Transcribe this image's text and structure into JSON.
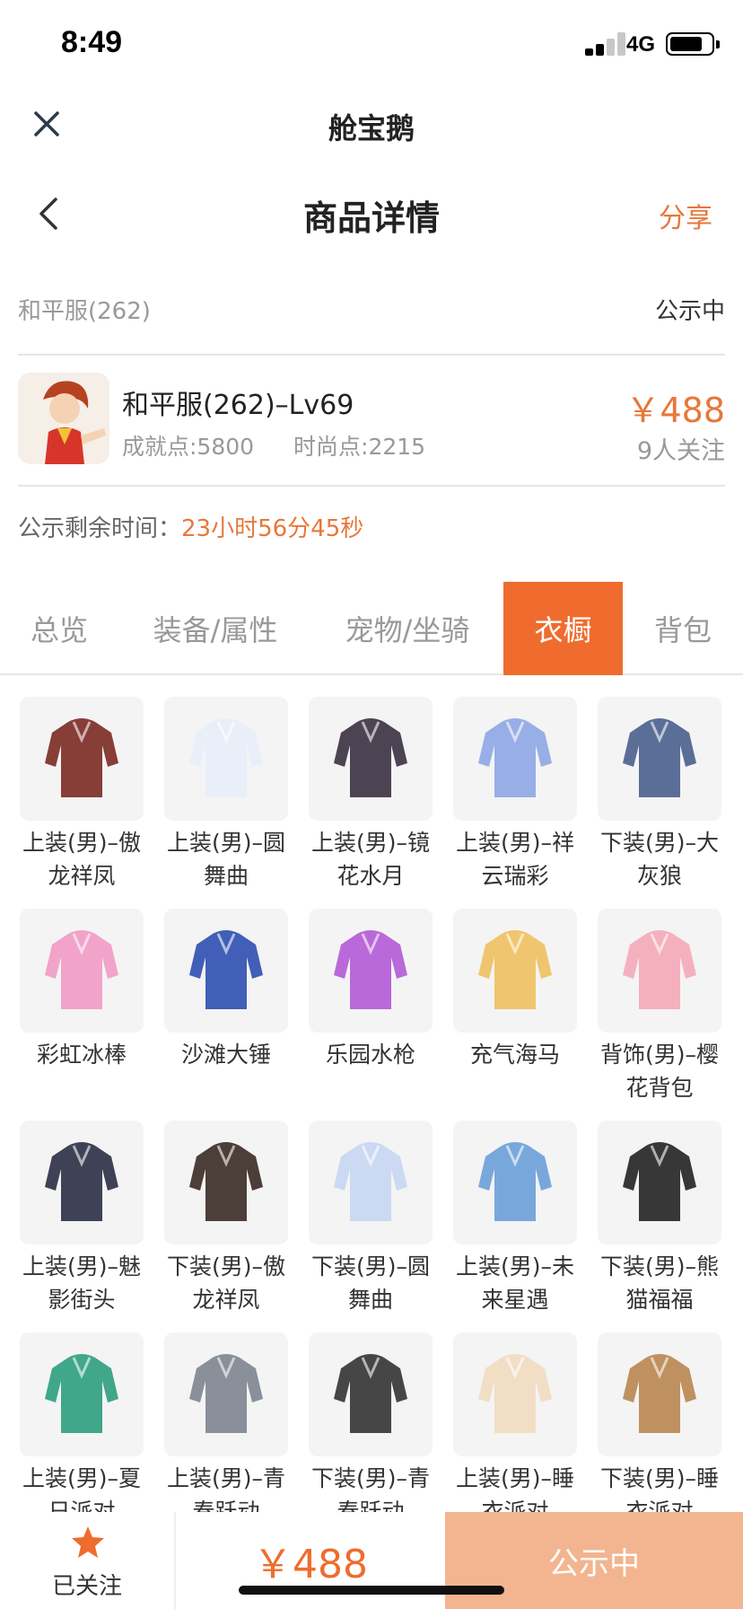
{
  "status_bar": {
    "time": "8:49",
    "network": "4G"
  },
  "app_bar": {
    "title": "舱宝鹅"
  },
  "nav": {
    "title": "商品详情",
    "share": "分享"
  },
  "listing": {
    "server": "和平服(262)",
    "status": "公示中",
    "product_name": "和平服(262)–Lv69",
    "achievement": "成就点:5800",
    "fashion": "时尚点:2215",
    "price": "￥488",
    "followers": "9人关注",
    "countdown_label": "公示剩余时间：",
    "countdown_value": "23小时56分45秒"
  },
  "tabs": [
    {
      "label": "总览",
      "active": false
    },
    {
      "label": "装备/属性",
      "active": false
    },
    {
      "label": "宠物/坐骑",
      "active": false
    },
    {
      "label": "衣橱",
      "active": true
    },
    {
      "label": "背包",
      "active": false
    }
  ],
  "wardrobe": [
    {
      "label": "上装(男)–傲龙祥凤",
      "icon": "dark-armor-top-icon",
      "color": "#7a2a22"
    },
    {
      "label": "上装(男)–圆舞曲",
      "icon": "white-suit-top-icon",
      "color": "#e8eef8"
    },
    {
      "label": "上装(男)–镜花水月",
      "icon": "crimson-coat-top-icon",
      "color": "#3a3140"
    },
    {
      "label": "上装(男)–祥云瑞彩",
      "icon": "blue-robe-top-icon",
      "color": "#8ea6e6"
    },
    {
      "label": "下装(男)–大灰狼",
      "icon": "grey-pants-icon",
      "color": "#4a5f8e"
    },
    {
      "label": "彩虹冰棒",
      "icon": "rainbow-popsicle-icon",
      "color": "#f29ac4"
    },
    {
      "label": "沙滩大锤",
      "icon": "beach-hammer-icon",
      "color": "#2f4fb0"
    },
    {
      "label": "乐园水枪",
      "icon": "water-gun-icon",
      "color": "#b35ad6"
    },
    {
      "label": "充气海马",
      "icon": "inflatable-bow-icon",
      "color": "#f0c060"
    },
    {
      "label": "背饰(男)–樱花背包",
      "icon": "sakura-backpack-icon",
      "color": "#f5a8b8"
    },
    {
      "label": "上装(男)–魅影街头",
      "icon": "phantom-street-top-icon",
      "color": "#2b2f45"
    },
    {
      "label": "下装(男)–傲龙祥凤",
      "icon": "dark-pants-icon",
      "color": "#3a2a24"
    },
    {
      "label": "下装(男)–圆舞曲",
      "icon": "white-pants-icon",
      "color": "#c8d6f2"
    },
    {
      "label": "上装(男)–未来星遇",
      "icon": "future-jacket-icon",
      "color": "#6aa0d8"
    },
    {
      "label": "下装(男)–熊猫福福",
      "icon": "panda-pants-icon",
      "color": "#222222"
    },
    {
      "label": "上装(男)–夏日派对",
      "icon": "summer-shirt-icon",
      "color": "#2e9e7e"
    },
    {
      "label": "上装(男)–青春跃动",
      "icon": "youth-vest-icon",
      "color": "#7d8590"
    },
    {
      "label": "下装(男)–青春跃动",
      "icon": "sneakers-icon",
      "color": "#333333"
    },
    {
      "label": "上装(男)–睡衣派对",
      "icon": "pajama-top-icon",
      "color": "#f2dcc0"
    },
    {
      "label": "下装(男)–睡衣派对",
      "icon": "slippers-icon",
      "color": "#b98650"
    }
  ],
  "footer": {
    "follow_label": "已关注",
    "price": "￥488",
    "status": "公示中",
    "accent": "#ef6c2e"
  }
}
